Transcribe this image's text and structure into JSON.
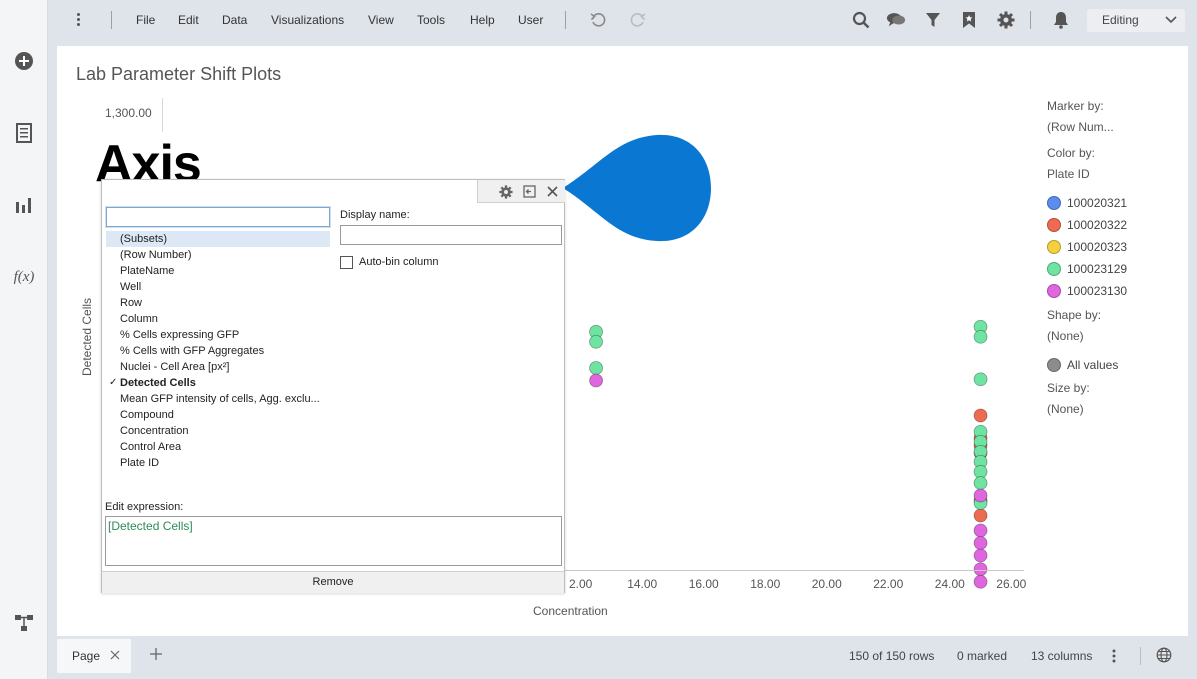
{
  "menu": {
    "items": [
      "File",
      "Edit",
      "Data",
      "Visualizations",
      "View",
      "Tools",
      "Help",
      "User"
    ],
    "mode": "Editing"
  },
  "toolbar_icons": [
    "undo-icon",
    "redo-icon",
    "search-icon",
    "comments-icon",
    "filter-icon",
    "bookmark-icon",
    "gear-icon",
    "notifications-icon"
  ],
  "left_rail": {
    "icons": [
      "add-icon",
      "data-table-icon",
      "bar-chart-icon",
      "function-icon",
      "data-flow-icon"
    ],
    "fx_label": "f(x)"
  },
  "page": {
    "title": "Lab Parameter Shift Plots"
  },
  "axis_overlay": {
    "big_label": "Axis",
    "y_top_tick": "1,300.00"
  },
  "dialog": {
    "search_value": "",
    "columns": [
      {
        "label": "(Subsets)",
        "highlighted": true,
        "checked": false
      },
      {
        "label": "(Row Number)",
        "highlighted": false,
        "checked": false
      },
      {
        "label": "PlateName",
        "highlighted": false,
        "checked": false
      },
      {
        "label": "Well",
        "highlighted": false,
        "checked": false
      },
      {
        "label": "Row",
        "highlighted": false,
        "checked": false
      },
      {
        "label": "Column",
        "highlighted": false,
        "checked": false
      },
      {
        "label": "% Cells expressing GFP",
        "highlighted": false,
        "checked": false
      },
      {
        "label": "% Cells with GFP Aggregates",
        "highlighted": false,
        "checked": false
      },
      {
        "label": "Nuclei - Cell Area [px²]",
        "highlighted": false,
        "checked": false
      },
      {
        "label": "Detected Cells",
        "highlighted": false,
        "checked": true
      },
      {
        "label": "Mean GFP intensity of cells, Agg. exclu...",
        "highlighted": false,
        "checked": false
      },
      {
        "label": "Compound",
        "highlighted": false,
        "checked": false
      },
      {
        "label": "Concentration",
        "highlighted": false,
        "checked": false
      },
      {
        "label": "Control Area",
        "highlighted": false,
        "checked": false
      },
      {
        "label": "Plate ID",
        "highlighted": false,
        "checked": false
      }
    ],
    "check_mark": "✓",
    "display_name_label": "Display name:",
    "display_name_value": "",
    "autobin_label": "Auto-bin column",
    "autobin_checked": false,
    "edit_expression_label": "Edit expression:",
    "expression": "[Detected Cells]",
    "remove_label": "Remove"
  },
  "chart_data": {
    "type": "scatter",
    "xlabel": "Concentration",
    "ylabel": "Detected Cells",
    "x_tick_labels": [
      "2.00",
      "14.00",
      "16.00",
      "18.00",
      "20.00",
      "22.00",
      "24.00",
      "26.00"
    ],
    "x_ticks": [
      12,
      14,
      16,
      18,
      20,
      22,
      24,
      26
    ],
    "xlim": [
      11.75,
      26.25
    ],
    "y_visible_tick": "1,300.00",
    "series": [
      {
        "name": "100020321",
        "color": "#5b8def",
        "points": []
      },
      {
        "name": "100020322",
        "color": "#ee6a50",
        "points": [
          {
            "x": 25.0,
            "y": 0.47
          },
          {
            "x": 25.0,
            "y": 0.56
          },
          {
            "x": 25.0,
            "y": 0.59
          },
          {
            "x": 25.0,
            "y": 0.62
          },
          {
            "x": 25.0,
            "y": 0.81
          },
          {
            "x": 25.0,
            "y": 0.87
          }
        ]
      },
      {
        "name": "100020323",
        "color": "#f4d03f",
        "points": []
      },
      {
        "name": "100023129",
        "color": "#6ee3a2",
        "points": [
          {
            "x": 12.5,
            "y": 0.135
          },
          {
            "x": 12.5,
            "y": 0.175
          },
          {
            "x": 12.5,
            "y": 0.28
          },
          {
            "x": 25.0,
            "y": 0.115
          },
          {
            "x": 25.0,
            "y": 0.155
          },
          {
            "x": 25.0,
            "y": 0.325
          },
          {
            "x": 25.0,
            "y": 0.535
          },
          {
            "x": 25.0,
            "y": 0.575
          },
          {
            "x": 25.0,
            "y": 0.615
          },
          {
            "x": 25.0,
            "y": 0.655
          },
          {
            "x": 25.0,
            "y": 0.695
          },
          {
            "x": 25.0,
            "y": 0.74
          },
          {
            "x": 25.0,
            "y": 0.82
          }
        ]
      },
      {
        "name": "100023130",
        "color": "#e066e0",
        "points": [
          {
            "x": 12.5,
            "y": 0.33
          },
          {
            "x": 25.0,
            "y": 0.79
          },
          {
            "x": 25.0,
            "y": 0.93
          },
          {
            "x": 25.0,
            "y": 0.98
          },
          {
            "x": 25.0,
            "y": 1.03
          },
          {
            "x": 25.0,
            "y": 1.085
          },
          {
            "x": 25.0,
            "y": 1.135
          }
        ]
      }
    ]
  },
  "legend": {
    "marker_by_label": "Marker by:",
    "marker_by_value": "(Row Num...",
    "color_by_label": "Color by:",
    "color_by_value": "Plate ID",
    "items": [
      {
        "label": "100020321",
        "color": "#5b8def"
      },
      {
        "label": "100020322",
        "color": "#ee6a50"
      },
      {
        "label": "100020323",
        "color": "#f4d03f"
      },
      {
        "label": "100023129",
        "color": "#6ee3a2"
      },
      {
        "label": "100023130",
        "color": "#e066e0"
      }
    ],
    "shape_by_label": "Shape by:",
    "shape_by_value": "(None)",
    "shape_all_label": "All values",
    "shape_all_color": "#8c8c8c",
    "size_by_label": "Size by:",
    "size_by_value": "(None)"
  },
  "status": {
    "page_tab": "Page",
    "rows": "150 of 150 rows",
    "marked": "0 marked",
    "columns": "13 columns"
  },
  "colors": {
    "accent_blue": "#0078d4",
    "teardrop": "#0a78d2"
  }
}
